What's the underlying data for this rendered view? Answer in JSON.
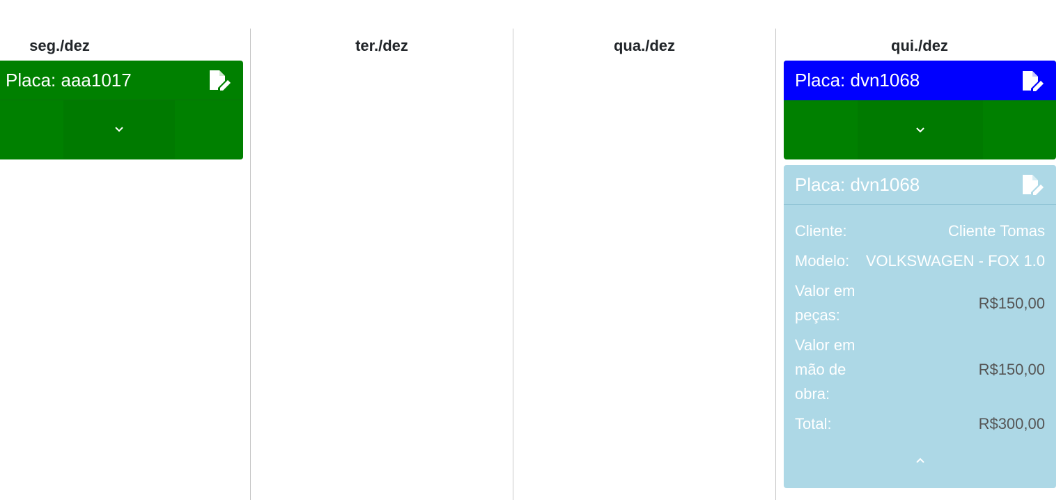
{
  "days": {
    "mon": "seg./dez",
    "tue": "ter./dez",
    "wed": "qua./dez",
    "thu": "qui./dez"
  },
  "cards": {
    "mon_card": {
      "plate": "Placa: aaa1017",
      "header_color": "#008000",
      "body_color": "#008000"
    },
    "thu_card_1": {
      "plate": "Placa: dvn1068",
      "header_color": "#0000ff",
      "body_color": "#008000"
    },
    "thu_card_2": {
      "plate": "Placa: dvn1068",
      "color": "#add8e6",
      "client_label": "Cliente:",
      "client_value": "Cliente Tomas",
      "model_label": "Modelo:",
      "model_value": "VOLKSWAGEN - FOX 1.0",
      "parts_label": "Valor em peças:",
      "parts_value": "R$150,00",
      "labor_label": "Valor em mão de obra:",
      "labor_value": "R$150,00",
      "total_label": "Total:",
      "total_value": "R$300,00"
    }
  },
  "icons": {
    "edit": "file-edit-icon",
    "expand": "chevron-down-icon",
    "collapse": "chevron-up-icon"
  }
}
